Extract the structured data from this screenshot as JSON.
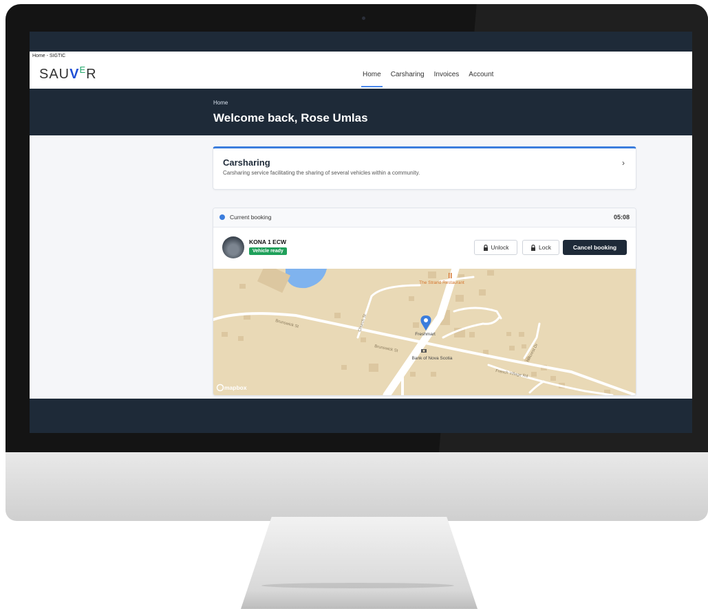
{
  "header": {
    "tab_title": "Home - SIGTIC",
    "logo_prefix": "SAU",
    "logo_v": "V",
    "logo_e": "E",
    "logo_suffix": "R",
    "nav": [
      "Home",
      "Carsharing",
      "Invoices",
      "Account"
    ],
    "active_nav": "Home"
  },
  "hero": {
    "breadcrumb": "Home",
    "welcome": "Welcome back, Rose Umlas"
  },
  "carsharing_card": {
    "title": "Carsharing",
    "description": "Carsharing service facilitating the sharing of several vehicles within a community."
  },
  "booking": {
    "label": "Current booking",
    "time": "05:08",
    "vehicle": "KONA 1 ECW",
    "status": "Vehicle ready",
    "buttons": {
      "unlock": "Unlock",
      "lock": "Lock",
      "cancel": "Cancel booking"
    }
  },
  "map": {
    "labels": {
      "restaurant": "The Strand Restaurant",
      "brunswick_1": "Brunswick St",
      "brunswick_2": "Brunswick St",
      "church": "Church St",
      "freshmart": "Freshmart",
      "bank": "Bank of Nova Scotia",
      "french_village": "French Village Rd",
      "hillcrest": "Hillcrest Dr",
      "attribution": "mapbox"
    }
  },
  "colors": {
    "dark_navy": "#1e2a38",
    "accent_blue": "#3b7ddd",
    "ready_green": "#1fa05a",
    "map_land": "#e9d9b6",
    "map_water": "#7fb3ee",
    "map_road": "#ffffff"
  },
  "icons": [
    "chevron-right-icon",
    "lock-icon",
    "map-pin-icon",
    "restaurant-icon",
    "bank-icon",
    "mapbox-logo-icon"
  ]
}
